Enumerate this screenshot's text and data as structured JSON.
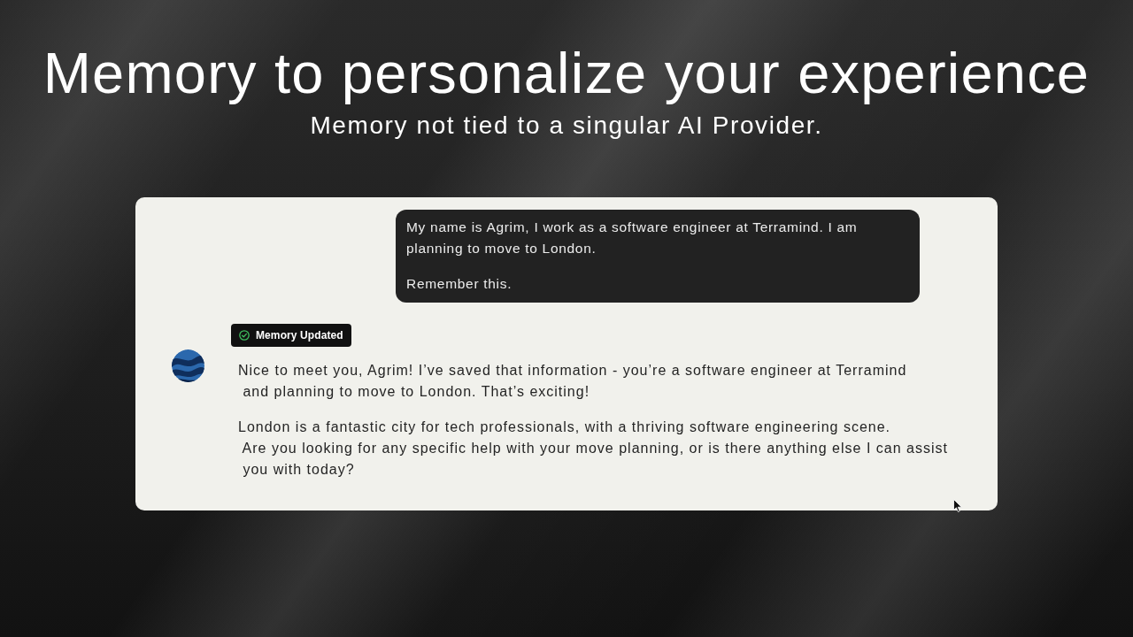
{
  "header": {
    "title": "Memory to personalize your experience",
    "subtitle": "Memory not tied to a singular AI Provider."
  },
  "chat": {
    "messages": [
      {
        "kind": "user",
        "paragraphs": [
          "My name is Agrim, I work as a software engineer at Terramind. I am planning to move to London.",
          "Remember this."
        ]
      },
      {
        "kind": "assistant",
        "badge": {
          "label": "Memory Updated"
        },
        "paragraphs": [
          "Nice to meet you, Agrim! I’ve saved that information - you’re a software engineer at Terramind\n and planning to move to London. That’s exciting!",
          "London is a fantastic city for tech professionals, with a thriving software engineering scene.\n Are you looking for any specific help with your move planning, or is there anything else I can assist\n you with today?"
        ]
      }
    ]
  }
}
